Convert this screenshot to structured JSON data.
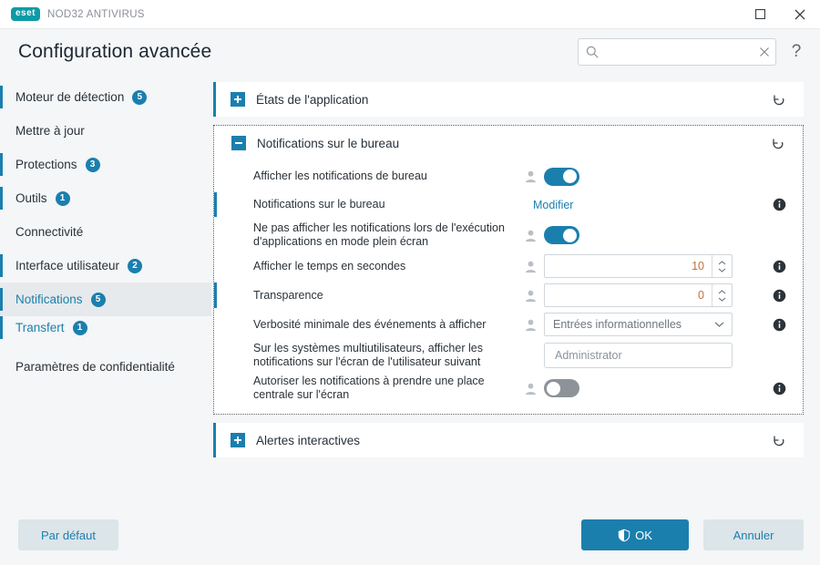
{
  "titlebar": {
    "logo_text": "eset",
    "product_name": "NOD32 ANTIVIRUS",
    "maximize_label": "Maximize",
    "close_label": "Close"
  },
  "header": {
    "title": "Configuration avancée",
    "search_value": "",
    "search_placeholder": "",
    "help_label": "?"
  },
  "sidebar": {
    "items": [
      {
        "label": "Moteur de détection",
        "badge": "5",
        "marker": true,
        "active": false,
        "child": false
      },
      {
        "label": "Mettre à jour",
        "badge": "",
        "marker": false,
        "active": false,
        "child": false
      },
      {
        "label": "Protections",
        "badge": "3",
        "marker": true,
        "active": false,
        "child": false
      },
      {
        "label": "Outils",
        "badge": "1",
        "marker": true,
        "active": false,
        "child": false
      },
      {
        "label": "Connectivité",
        "badge": "",
        "marker": false,
        "active": false,
        "child": false
      },
      {
        "label": "Interface utilisateur",
        "badge": "2",
        "marker": true,
        "active": false,
        "child": false
      },
      {
        "label": "Notifications",
        "badge": "5",
        "marker": true,
        "active": true,
        "child": false
      },
      {
        "label": "Transfert",
        "badge": "1",
        "marker": true,
        "active": false,
        "child": true
      },
      {
        "label": "Paramètres de confidentialité",
        "badge": "",
        "marker": false,
        "active": false,
        "child": false
      }
    ]
  },
  "main": {
    "sections": [
      {
        "title": "États de l'application",
        "expander": "plus",
        "expanded": false,
        "revert_name": "revert-icon"
      },
      {
        "title": "Notifications sur le bureau",
        "expander": "minus",
        "expanded": true,
        "revert_name": "revert-icon",
        "rows": [
          {
            "label": "Afficher les notifications de bureau",
            "type": "toggle",
            "state": "on",
            "user_icon": true,
            "info": false,
            "edge": false
          },
          {
            "label": "Notifications sur le bureau",
            "type": "link",
            "link_text": "Modifier",
            "user_icon": false,
            "info": true,
            "edge": true
          },
          {
            "label": "Ne pas afficher les notifications lors de l'exécution d'applications en mode plein écran",
            "type": "toggle",
            "state": "on",
            "user_icon": true,
            "info": false,
            "edge": false
          },
          {
            "label": "Afficher le temps en secondes",
            "type": "spinner",
            "value": "10",
            "user_icon": true,
            "info": true,
            "edge": false
          },
          {
            "label": "Transparence",
            "type": "spinner",
            "value": "0",
            "user_icon": true,
            "info": true,
            "edge": true
          },
          {
            "label": "Verbosité minimale des événements à afficher",
            "type": "select",
            "value": "Entrées informationnelles",
            "user_icon": true,
            "info": true,
            "edge": false
          },
          {
            "label": "Sur les systèmes multiutilisateurs, afficher les notifications sur l'écran de l'utilisateur suivant",
            "type": "text",
            "value": "",
            "placeholder": "Administrator",
            "user_icon": false,
            "info": false,
            "edge": false
          },
          {
            "label": "Autoriser les notifications à prendre une place centrale sur l'écran",
            "type": "toggle",
            "state": "off",
            "user_icon": true,
            "info": true,
            "edge": false
          }
        ]
      },
      {
        "title": "Alertes interactives",
        "expander": "plus",
        "expanded": false,
        "revert_name": "revert-icon"
      }
    ]
  },
  "footer": {
    "default_label": "Par défaut",
    "ok_label": "OK",
    "cancel_label": "Annuler"
  },
  "colors": {
    "accent": "#1b7fae",
    "brand_teal": "#0d9ba5",
    "value_orange": "#c2703c",
    "toggle_off": "#8d9399",
    "page_bg": "#f4f6f7"
  }
}
